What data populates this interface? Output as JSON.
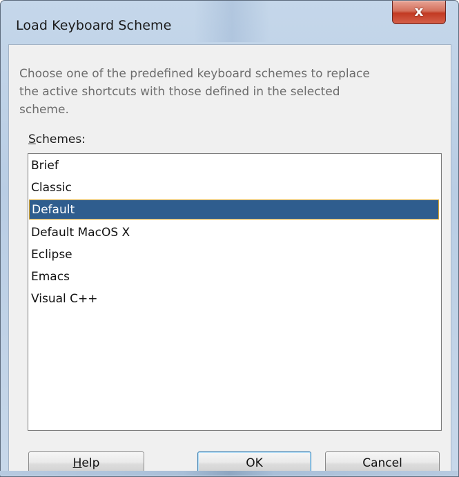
{
  "window": {
    "title": "Load Keyboard Scheme",
    "close_glyph": "x",
    "close_icon": "close-icon"
  },
  "dialog": {
    "description_lines": [
      "Choose one of the predefined keyboard schemes to replace",
      "the active shortcuts with those defined in the selected",
      "scheme."
    ],
    "schemes_label_mnemonic": "S",
    "schemes_label_rest": "chemes:",
    "schemes": [
      "Brief",
      "Classic",
      "Default",
      "Default MacOS X",
      "Eclipse",
      "Emacs",
      "Visual C++"
    ],
    "selected_scheme": "Default"
  },
  "buttons": {
    "help_mnemonic": "H",
    "help_rest": "elp",
    "ok": "OK",
    "cancel": "Cancel"
  },
  "colors": {
    "selection": "#2f5d8e",
    "selection_border": "#d8a42b",
    "close_button": "#c23a23"
  }
}
